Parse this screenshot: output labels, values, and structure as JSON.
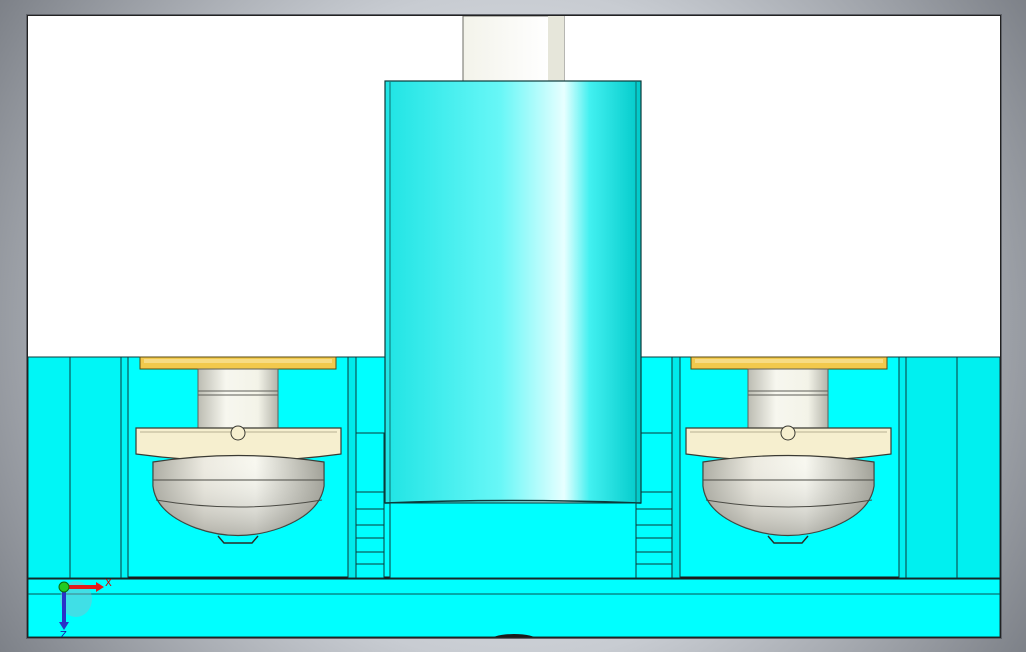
{
  "viewport": {
    "background": "#ffffff",
    "model_color_primary": "#00ffff",
    "model_color_accent": "#f2c94c",
    "model_color_cream": "#f6efcf",
    "model_color_metal": "#d9d9cf"
  },
  "triad": {
    "x_label": "X",
    "z_label": "Z",
    "x_color": "#e31b1b",
    "z_color": "#2a31c8",
    "origin_color": "#22cc22"
  }
}
